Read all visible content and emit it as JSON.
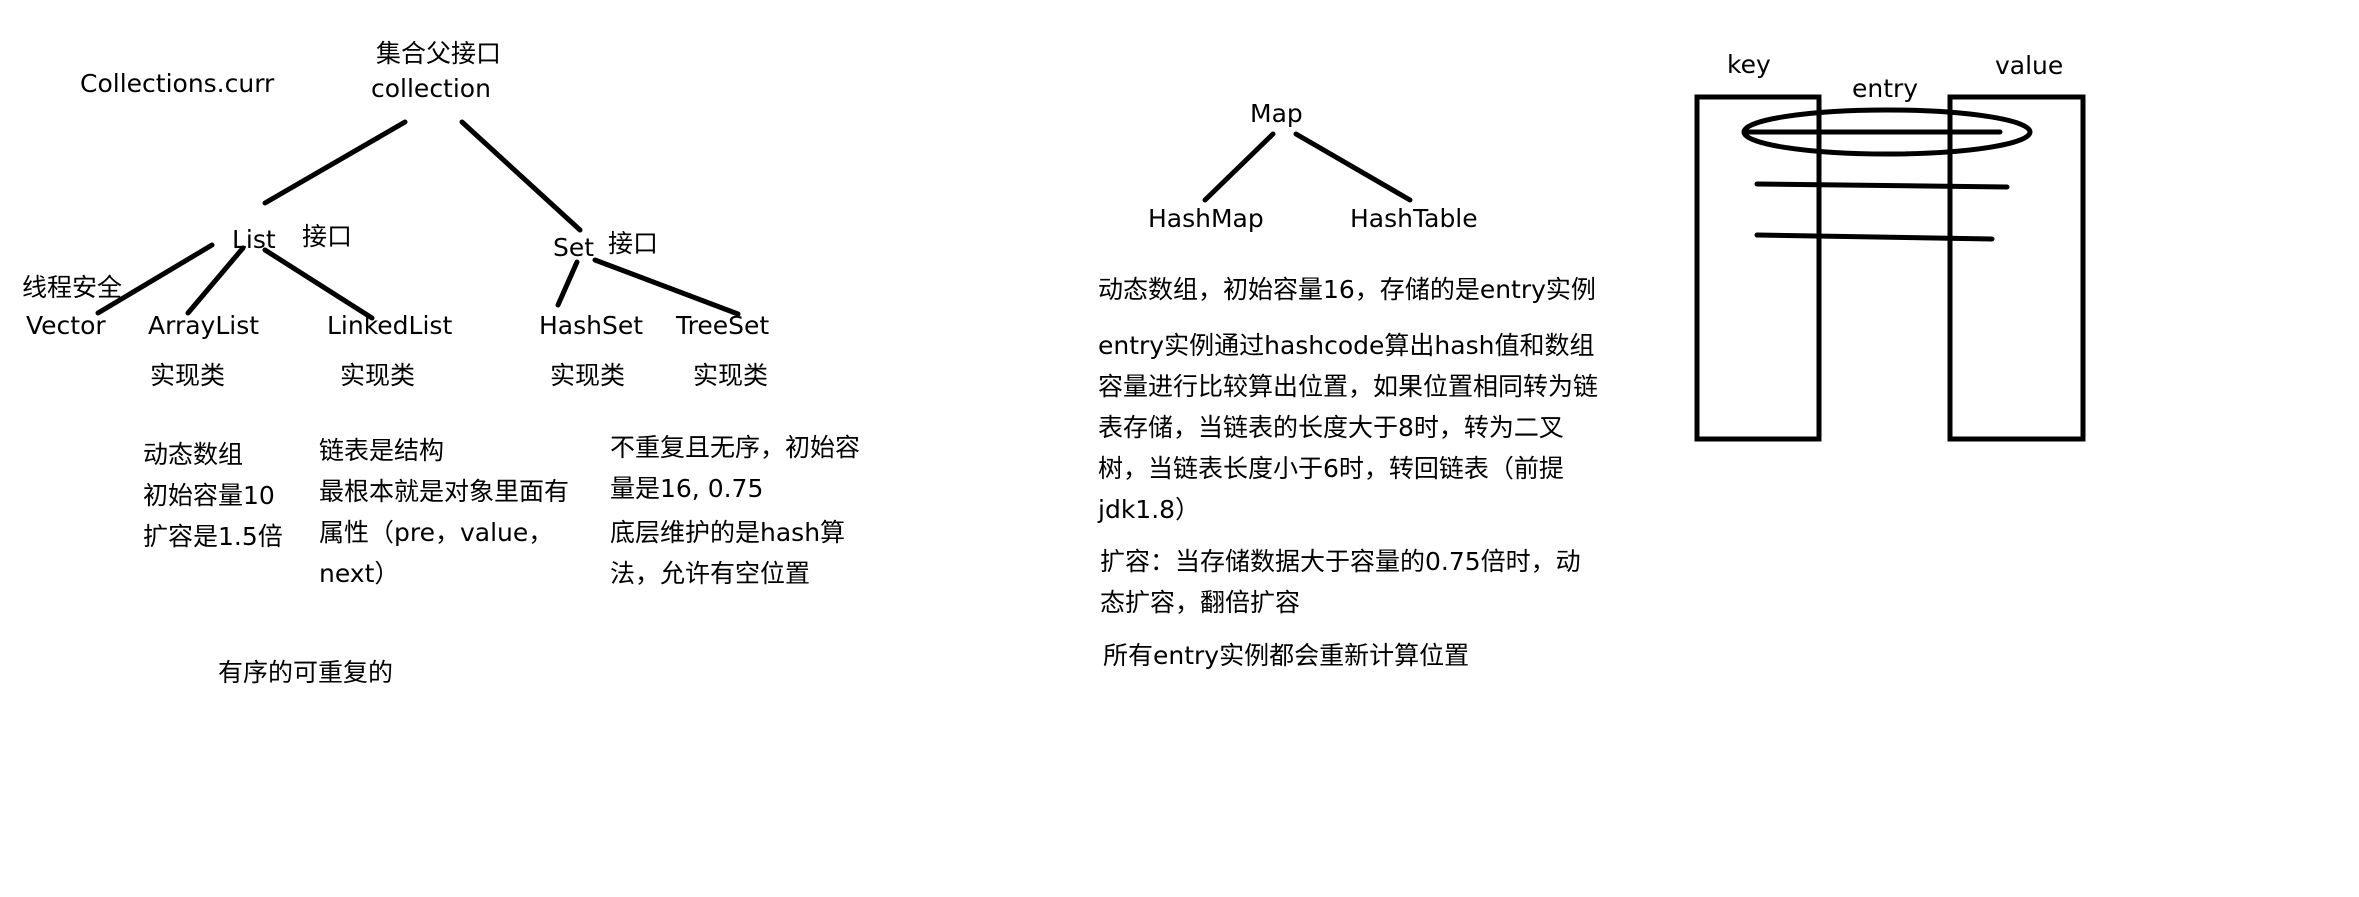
{
  "collection_tree": {
    "collections_curr": "Collections.curr",
    "parent_title": "集合父接口",
    "collection": "collection",
    "list": "List",
    "list_interface": "接口",
    "set": "Set",
    "set_interface": "接口",
    "thread_safe": "线程安全",
    "vector": "Vector",
    "arraylist": "ArrayList",
    "linkedlist": "LinkedList",
    "hashset": "HashSet",
    "treeset": "TreeSet",
    "impl_arraylist": "实现类",
    "impl_linkedlist": "实现类",
    "impl_hashset": "实现类",
    "impl_treeset": "实现类",
    "arraylist_notes": [
      "动态数组",
      "初始容量10",
      "扩容是1.5倍"
    ],
    "linkedlist_notes": [
      "链表是结构",
      "最根本就是对象里面有",
      "属性（pre，value，",
      "next）"
    ],
    "set_notes": [
      "不重复且无序，初始容",
      "量是16, 0.75",
      "底层维护的是hash算",
      "法，允许有空位置"
    ],
    "list_summary": "有序的可重复的"
  },
  "map_tree": {
    "map": "Map",
    "hashmap": "HashMap",
    "hashtable": "HashTable",
    "note1": "动态数组，初始容量16，存储的是entry实例",
    "note2": [
      "entry实例通过hashcode算出hash值和数组",
      "容量进行比较算出位置，如果位置相同转为链",
      "表存储，当链表的长度大于8时，转为二叉",
      "树，当链表长度小于6时，转回链表（前提",
      "jdk1.8）"
    ],
    "note3": [
      "扩容：当存储数据大于容量的0.75倍时，动",
      "态扩容，翻倍扩容"
    ],
    "note4": "所有entry实例都会重新计算位置"
  },
  "entry_diagram": {
    "key": "key",
    "entry": "entry",
    "value": "value"
  }
}
